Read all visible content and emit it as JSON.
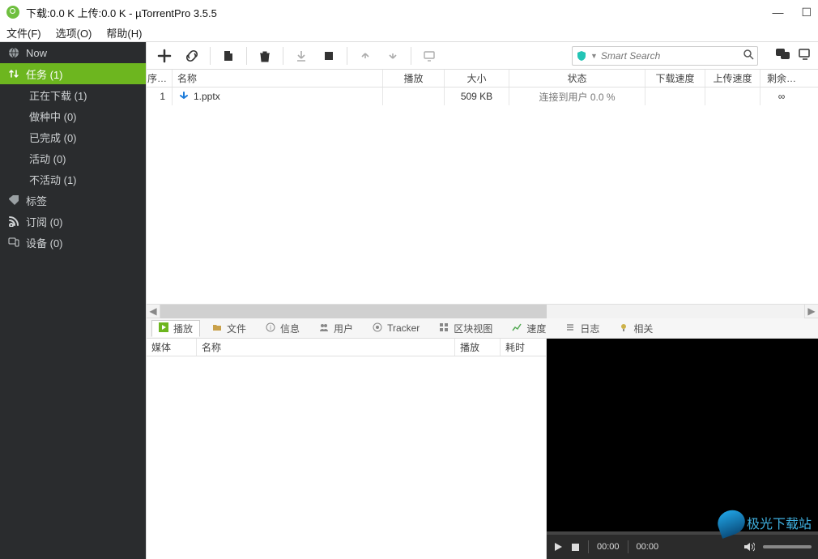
{
  "window": {
    "title": "下载:0.0 K 上传:0.0 K - µTorrentPro 3.5.5",
    "min": "—",
    "max": "☐",
    "close": "✕"
  },
  "menu": {
    "file": "文件(F)",
    "options": "选项(O)",
    "help": "帮助(H)"
  },
  "sidebar": {
    "now": "Now",
    "tasks": "任务 (1)",
    "downloading": "正在下载 (1)",
    "seeding": "做种中 (0)",
    "complete": "已完成 (0)",
    "active": "活动 (0)",
    "inactive": "不活动 (1)",
    "tags": "标签",
    "feeds": "订阅 (0)",
    "devices": "设备 (0)"
  },
  "search": {
    "placeholder": "Smart Search"
  },
  "columns": {
    "order": "序…",
    "name": "名称",
    "play": "播放",
    "size": "大小",
    "state": "状态",
    "down": "下载速度",
    "up": "上传速度",
    "remain": "剩余…"
  },
  "rows": [
    {
      "order": "1",
      "name": "1.pptx",
      "size": "509 KB",
      "state": "连接到用户 0.0 %",
      "remain": "∞"
    }
  ],
  "tabs": {
    "play": "播放",
    "files": "文件",
    "info": "信息",
    "peers": "用户",
    "tracker": "Tracker",
    "pieces": "区块视图",
    "speed": "速度",
    "log": "日志",
    "related": "相关"
  },
  "bcols": {
    "media": "媒体",
    "name": "名称",
    "play": "播放",
    "dur": "耗时"
  },
  "player": {
    "t1": "00:00",
    "t2": "00:00"
  },
  "watermark": "极光下载站"
}
